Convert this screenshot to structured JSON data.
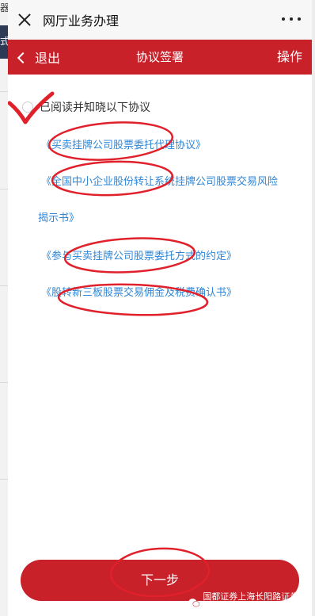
{
  "background": {
    "partial_text_top": "器",
    "partial_text_dark": "式"
  },
  "topbar": {
    "title": "网厅业务办理"
  },
  "header": {
    "back_label": "退出",
    "title": "协议签署",
    "action_label": "操作"
  },
  "agreement": {
    "label": "已阅读并知晓以下协议",
    "checked": false
  },
  "documents": [
    {
      "line1": "《买卖挂牌公司股票委托代理协议》"
    },
    {
      "line1": "《全国中小企业股份转让系统挂牌公司股票交易风险",
      "line2": "揭示书》"
    },
    {
      "line1": "《参与买卖挂牌公司股票委托方式的约定》"
    },
    {
      "line1": "《股转新三板股票交易佣金及税费确认书》"
    }
  ],
  "footer": {
    "next_label": "下一步"
  },
  "watermark": {
    "text": "国都证券上海长阳路证券营业部"
  },
  "colors": {
    "brand_red": "#c8212a",
    "link_blue": "#2f86d6",
    "annotation_red": "#e0202a"
  }
}
